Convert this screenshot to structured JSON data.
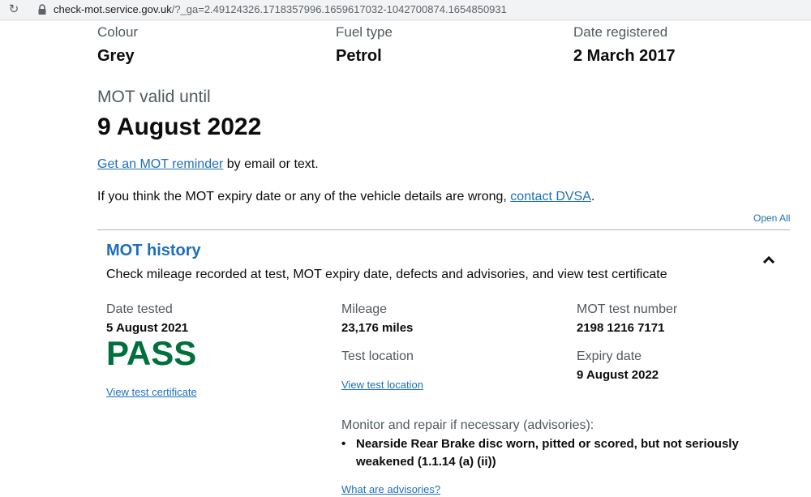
{
  "browser": {
    "url_host": "check-mot.service.gov.uk",
    "url_path": "/?_ga=2.49124326.1718357996.1659617032-1042700874.1654850931"
  },
  "vehicle": {
    "colour_label": "Colour",
    "colour_value": "Grey",
    "fuel_label": "Fuel type",
    "fuel_value": "Petrol",
    "registered_label": "Date registered",
    "registered_value": "2 March 2017"
  },
  "mot": {
    "valid_label": "MOT valid until",
    "valid_date": "9 August 2022",
    "reminder_link": "Get an MOT reminder",
    "reminder_suffix": " by email or text.",
    "wrong_text": "If you think the MOT expiry date or any of the vehicle details are wrong, ",
    "contact_link": "contact DVSA",
    "contact_suffix": "."
  },
  "history": {
    "open_all": "Open All",
    "title": "MOT history",
    "description": "Check mileage recorded at test, MOT expiry date, defects and advisories, and view test certificate",
    "date_tested_label": "Date tested",
    "date_tested_value": "5 August 2021",
    "result": "PASS",
    "view_certificate": "View test certificate",
    "mileage_label": "Mileage",
    "mileage_value": "23,176 miles",
    "location_label": "Test location",
    "view_location": "View test location",
    "test_number_label": "MOT test number",
    "test_number_value": "2198 1216 7171",
    "expiry_label": "Expiry date",
    "expiry_value": "9 August 2022",
    "advisories_label": "Monitor and repair if necessary (advisories):",
    "advisories": [
      "Nearside Rear Brake disc worn, pitted or scored, but not seriously weakened (1.1.14 (a) (ii))"
    ],
    "what_are_advisories": "What are advisories?"
  },
  "colors": {
    "link": "#1d70b8",
    "pass_green": "#00703c",
    "secondary_text": "#505a5f"
  }
}
